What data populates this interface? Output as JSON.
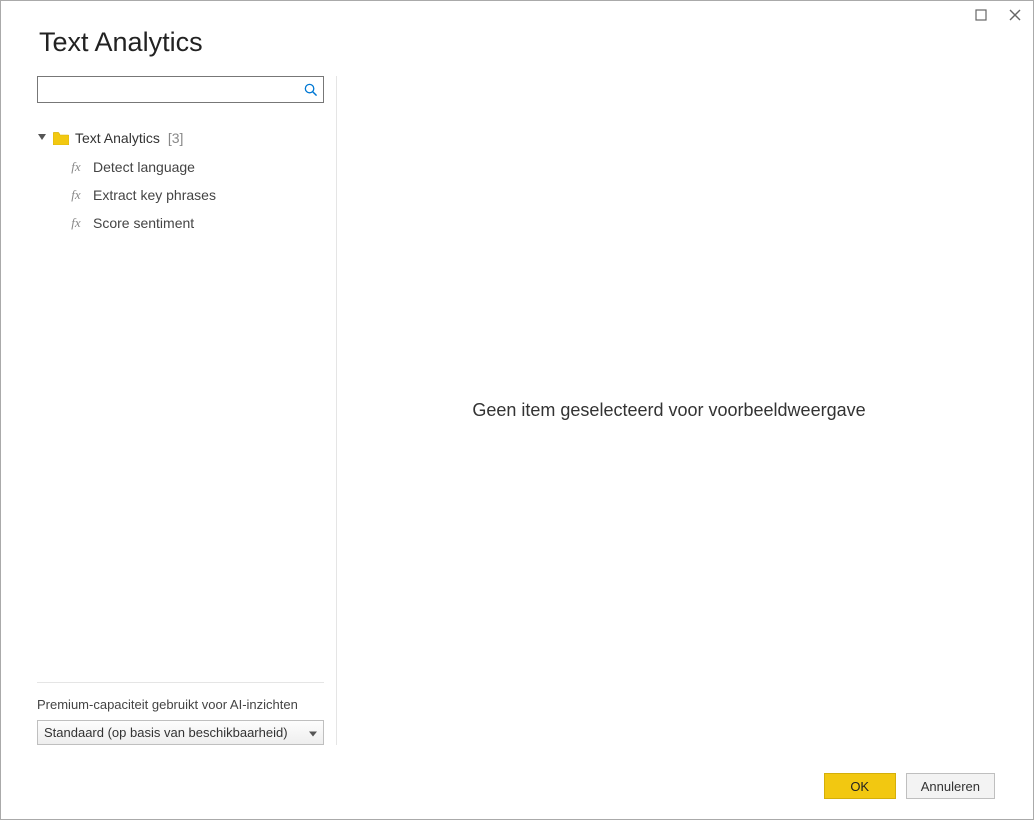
{
  "dialog": {
    "title": "Text Analytics"
  },
  "search": {
    "value": "",
    "placeholder": ""
  },
  "tree": {
    "folder_label": "Text Analytics",
    "folder_count": "[3]",
    "items": [
      {
        "label": "Detect language"
      },
      {
        "label": "Extract key phrases"
      },
      {
        "label": "Score sentiment"
      }
    ]
  },
  "sidebar_footer": {
    "label": "Premium-capaciteit gebruikt voor AI-inzichten",
    "combo_value": "Standaard (op basis van beschikbaarheid)"
  },
  "preview": {
    "empty_message": "Geen item geselecteerd voor voorbeeldweergave"
  },
  "buttons": {
    "ok": "OK",
    "cancel": "Annuleren"
  }
}
